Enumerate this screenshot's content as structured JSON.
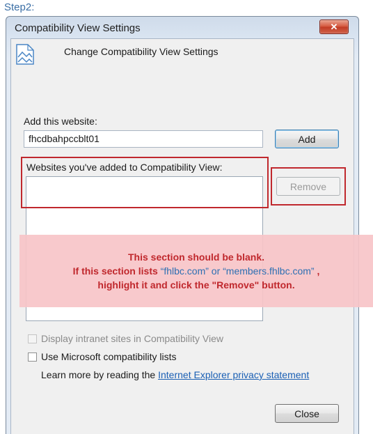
{
  "step_label": "Step2:",
  "window": {
    "title": "Compatibility View Settings",
    "close_glyph": "✕",
    "header_icon": "compatibility-view-icon",
    "header_text": "Change Compatibility View Settings"
  },
  "add_website": {
    "label": "Add this website:",
    "value": "fhcdbahpccblt01",
    "add_button": "Add"
  },
  "list": {
    "label": "Websites you've added to Compatibility View:",
    "items": [],
    "remove_button": "Remove"
  },
  "annotation": {
    "line1": "This section should be blank.",
    "line2_prefix": "If this section lists ",
    "line2_site1": "“fhlbc.com”",
    "line2_or": " or ",
    "line2_site2": "“members.fhlbc.com”",
    "line2_suffix": " ,",
    "line3": "highlight it and click the \"Remove\" button.",
    "highlight_color": "#c0282d"
  },
  "options": {
    "intranet_label": "Display intranet sites in Compatibility View",
    "intranet_checked": false,
    "microsoft_lists_label": "Use Microsoft compatibility lists",
    "microsoft_lists_checked": false
  },
  "learn_more": {
    "prefix": "Learn more by reading the ",
    "link": "Internet Explorer privacy statement"
  },
  "close_button": "Close"
}
